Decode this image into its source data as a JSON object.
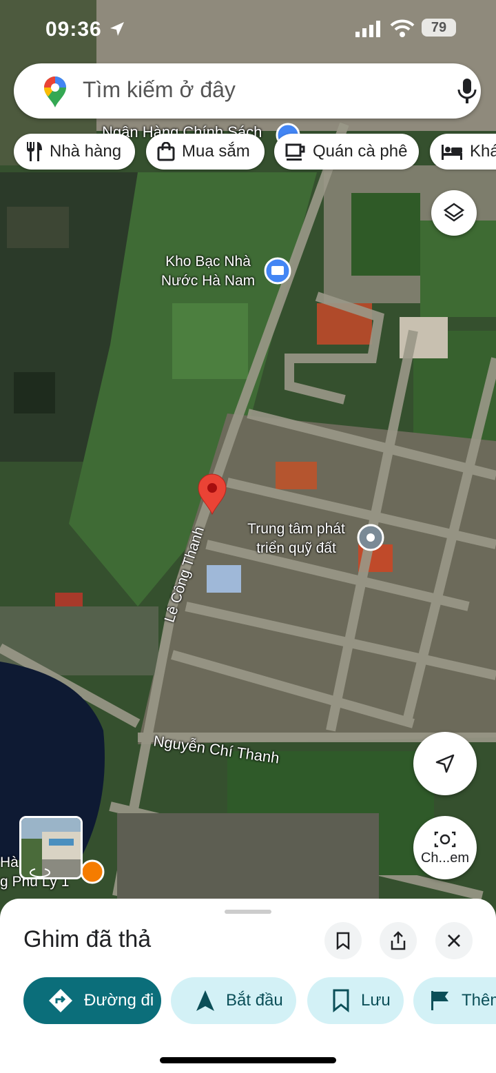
{
  "status_bar": {
    "time": "09:36",
    "battery": "79"
  },
  "search": {
    "placeholder": "Tìm kiếm ở đây"
  },
  "chips": [
    {
      "label": "Nhà hàng",
      "icon": "fork-knife-icon"
    },
    {
      "label": "Mua sắm",
      "icon": "shopping-bag-icon"
    },
    {
      "label": "Quán cà phê",
      "icon": "coffee-cup-icon"
    },
    {
      "label": "Khách sạn",
      "icon": "bed-icon"
    }
  ],
  "map": {
    "labels": {
      "bank_partial": "Ngân Hàng Chính Sách",
      "treasury_line1": "Kho Bạc Nhà",
      "treasury_line2": "Nước Hà Nam",
      "land_center_line1": "Trung tâm phát",
      "land_center_line2": "triển quỹ đất",
      "street_le_cong_thanh": "Lê Công Thanh",
      "street_nguyen_chi_thanh": "Nguyễn Chí Thanh",
      "bottom_left_line1": "Hà",
      "bottom_left_line2": "g Phủ Lý 1"
    },
    "colors": {
      "pin": "#ea4335",
      "water": "#0e1a33",
      "poi_blue": "#4285f4"
    }
  },
  "buttons": {
    "layers_icon": "layers-icon",
    "locate_icon": "navigation-arrow-icon",
    "lens_label": "Ch...em"
  },
  "sheet": {
    "title": "Ghim đã thả",
    "actions": [
      {
        "label": "Đường đi",
        "icon": "directions-icon"
      },
      {
        "label": "Bắt đầu",
        "icon": "navigation-icon"
      },
      {
        "label": "Lưu",
        "icon": "bookmark-icon"
      },
      {
        "label": "Thêm nhãn",
        "icon": "flag-icon"
      }
    ]
  },
  "accent": "#0b6e7a"
}
